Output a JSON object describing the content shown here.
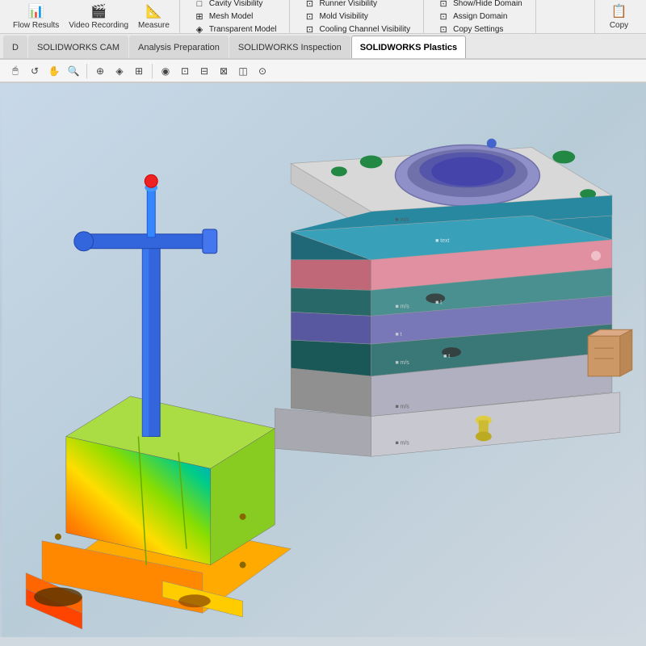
{
  "toolbar": {
    "row1": {
      "groups": [
        {
          "id": "left-buttons",
          "buttons": [
            {
              "label": "Flow Results",
              "icon": "📊"
            },
            {
              "label": "Video Recording",
              "icon": "🎥"
            },
            {
              "label": "Measure",
              "icon": "📏"
            }
          ]
        },
        {
          "id": "visibility-group",
          "items": [
            {
              "icon": "□",
              "label": "Cavity Visibility"
            },
            {
              "icon": "⊞",
              "label": "Mesh Model"
            },
            {
              "icon": "◈",
              "label": "Transparent Model"
            }
          ]
        },
        {
          "id": "runner-group",
          "items": [
            {
              "icon": "⊡",
              "label": "Runner Visibility"
            },
            {
              "icon": "⊡",
              "label": "Mold Visibility"
            },
            {
              "icon": "⊡",
              "label": "Cooling Channel Visibility"
            }
          ]
        },
        {
          "id": "domain-group",
          "items": [
            {
              "icon": "⊡",
              "label": "Show/Hide Domain"
            },
            {
              "icon": "⊡",
              "label": "Assign Domain"
            },
            {
              "icon": "⊡",
              "label": "Copy Settings"
            }
          ]
        }
      ],
      "copy_label": "Copy",
      "copy_icon": "📋"
    }
  },
  "tabs": [
    {
      "label": "D",
      "active": false
    },
    {
      "label": "SOLIDWORKS CAM",
      "active": false
    },
    {
      "label": "Analysis Preparation",
      "active": false
    },
    {
      "label": "SOLIDWORKS Inspection",
      "active": false
    },
    {
      "label": "SOLIDWORKS Plastics",
      "active": true
    }
  ],
  "icon_toolbar": {
    "icons": [
      "🔍",
      "🔎",
      "✏️",
      "⊕",
      "⊗",
      "◈",
      "⊞",
      "◉",
      "⊡",
      "⊟",
      "⊠",
      "◫",
      "⊙"
    ]
  },
  "models": {
    "left_model_label": "Colorful injection part with sprue",
    "right_model_label": "Mold assembly stack"
  }
}
